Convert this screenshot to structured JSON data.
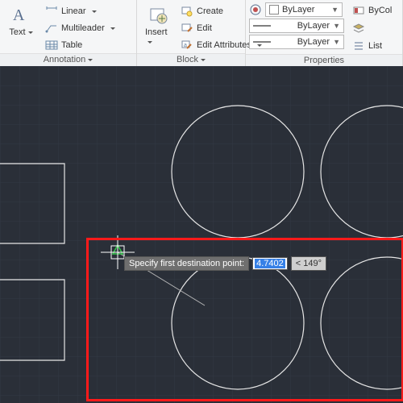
{
  "ribbon": {
    "annotation": {
      "title": "Annotation",
      "text": "Text",
      "linear": "Linear",
      "multileader": "Multileader",
      "table": "Table"
    },
    "block": {
      "title": "Block",
      "insert": "Insert",
      "create": "Create",
      "edit": "Edit",
      "editAttr": "Edit Attributes"
    },
    "properties": {
      "title": "Properties",
      "layer": "ByLayer",
      "linetype": "ByLayer",
      "lineweight": "ByLayer",
      "list": "List",
      "bycol": "ByCol"
    }
  },
  "prompt": {
    "label": "Specify first destination point:",
    "value": "4.7402",
    "angle": "< 149°"
  },
  "colors": {
    "accent": "#3680e6",
    "grid": "#313742",
    "canvas": "#2a2f38",
    "highlight": "#ff1a1a"
  }
}
